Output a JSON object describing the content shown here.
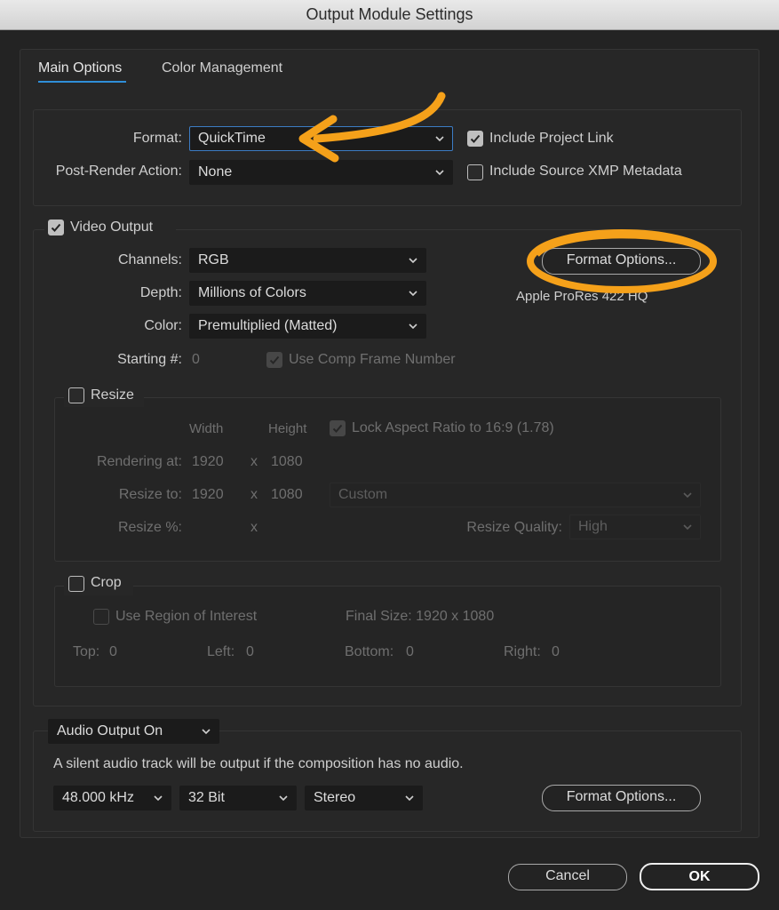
{
  "window": {
    "title": "Output Module Settings"
  },
  "tabs": [
    {
      "label": "Main Options",
      "active": true
    },
    {
      "label": "Color Management",
      "active": false
    }
  ],
  "format": {
    "format_label": "Format:",
    "format_value": "QuickTime",
    "post_render_label": "Post-Render Action:",
    "post_render_value": "None",
    "include_project_link": {
      "label": "Include Project Link",
      "checked": true
    },
    "include_xmp": {
      "label": "Include Source XMP Metadata",
      "checked": false
    }
  },
  "video": {
    "enabled_label": "Video Output",
    "enabled": true,
    "channels_label": "Channels:",
    "channels_value": "RGB",
    "depth_label": "Depth:",
    "depth_value": "Millions of Colors",
    "color_label": "Color:",
    "color_value": "Premultiplied (Matted)",
    "starting_label": "Starting #:",
    "starting_value": "0",
    "use_comp_frame": {
      "label": "Use Comp Frame Number",
      "checked": true
    },
    "format_options_label": "Format Options...",
    "codec_text": "Apple ProRes 422 HQ"
  },
  "resize": {
    "label": "Resize",
    "enabled": false,
    "width_header": "Width",
    "height_header": "Height",
    "lock_aspect": {
      "label": "Lock Aspect Ratio to 16:9 (1.78)",
      "checked": true
    },
    "rendering_label": "Rendering at:",
    "rendering_w": "1920",
    "rendering_h": "1080",
    "resize_to_label": "Resize to:",
    "resize_to_w": "1920",
    "resize_to_h": "1080",
    "resize_preset": "Custom",
    "percent_label": "Resize %:",
    "x_sep": "x",
    "quality_label": "Resize Quality:",
    "quality_value": "High"
  },
  "crop": {
    "label": "Crop",
    "enabled": false,
    "roi": {
      "label": "Use Region of Interest",
      "checked": false
    },
    "final_size": "Final Size: 1920 x 1080",
    "top_label": "Top:",
    "top_value": "0",
    "left_label": "Left:",
    "left_value": "0",
    "bottom_label": "Bottom:",
    "bottom_value": "0",
    "right_label": "Right:",
    "right_value": "0"
  },
  "audio": {
    "output_value": "Audio Output On",
    "note": "A silent audio track will be output if the composition has no audio.",
    "rate_value": "48.000 kHz",
    "bits_value": "32 Bit",
    "channels_value": "Stereo",
    "format_options_label": "Format Options..."
  },
  "footer": {
    "cancel_label": "Cancel",
    "ok_label": "OK"
  },
  "colors": {
    "accent": "#2f8ed8",
    "annotation": "#f5a11a",
    "background": "#232323"
  }
}
